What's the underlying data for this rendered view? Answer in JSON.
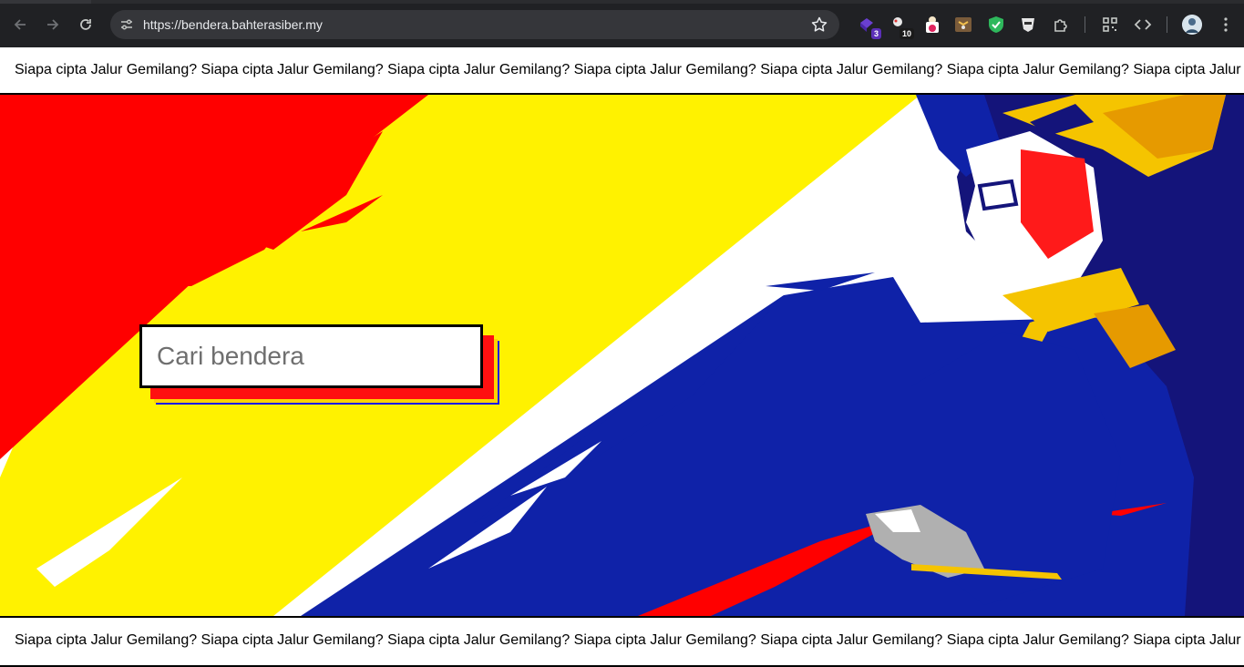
{
  "browser": {
    "url": "https://bendera.bahterasiber.my",
    "extensions": [
      {
        "icon": "puzzle-purple-extension-icon",
        "badge": "3"
      },
      {
        "icon": "tracker-extension-icon",
        "badge": "10"
      },
      {
        "icon": "popcorn-extension-icon",
        "badge": ""
      },
      {
        "icon": "shield-bird-extension-icon",
        "badge": ""
      },
      {
        "icon": "green-shield-extension-icon",
        "badge": ""
      },
      {
        "icon": "ghost-extension-icon",
        "badge": ""
      },
      {
        "icon": "extensions-puzzle-icon",
        "badge": ""
      }
    ]
  },
  "page": {
    "ticker_text": "Siapa cipta Jalur Gemilang? Siapa cipta Jalur Gemilang? Siapa cipta Jalur Gemilang? Siapa cipta Jalur Gemilang? Siapa cipta Jalur Gemilang? Siapa cipta Jalur Gemilang? Siapa cipta Jalur Gemilang?",
    "search": {
      "placeholder": "Cari bendera",
      "value": ""
    }
  },
  "colors": {
    "red": "#ff0000",
    "yellow": "#fff200",
    "blue": "#0f22a8",
    "navy": "#14147a",
    "chrome_bg": "#202124"
  }
}
